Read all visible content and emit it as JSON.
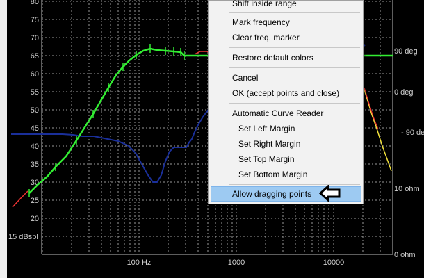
{
  "plot": {
    "y_ticks": [
      "80",
      "75",
      "70",
      "65",
      "60",
      "55",
      "50",
      "45",
      "40",
      "35",
      "30",
      "25",
      "20"
    ],
    "y_unit_label": "15 dBspl",
    "x_ticks": [
      "100 Hz",
      "1000",
      "10000"
    ],
    "right_ticks": [
      "90 deg",
      "0 deg",
      "- 90 deg",
      "10 ohm",
      "0 ohm"
    ],
    "colors": {
      "background": "#000000",
      "grid": "#9a9a9a",
      "spl_curve": "#33ee33",
      "spl_marker": "#ee3333",
      "impedance_curve": "#1a2f9a",
      "phase_curve": "#f2e23c"
    }
  },
  "context_menu": {
    "items": {
      "shift_inside_range": "Shift inside range",
      "mark_frequency": "Mark frequency",
      "clear_freq_marker": "Clear freq. marker",
      "restore_default_colors": "Restore default colors",
      "cancel": "Cancel",
      "ok_accept": "OK (accept points and close)",
      "automatic_curve_reader": "Automatic Curve Reader",
      "set_left_margin": "Set Left Margin",
      "set_right_margin": "Set Right Margin",
      "set_top_margin": "Set Top Margin",
      "set_bottom_margin": "Set Bottom Margin",
      "allow_dragging_points": "Allow dragging points"
    },
    "highlight_color": "#9dcaf2",
    "pointer_icon": "left-arrow-icon"
  }
}
